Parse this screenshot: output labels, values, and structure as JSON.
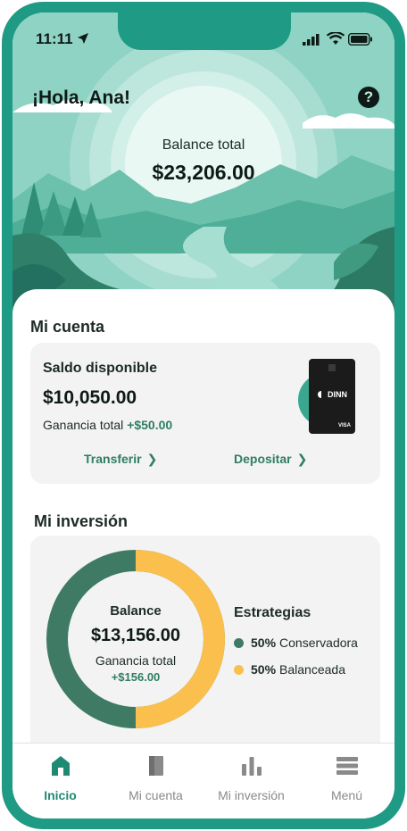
{
  "status_bar": {
    "time": "11:11"
  },
  "header": {
    "greeting": "¡Hola, Ana!",
    "help_icon": "question-circle-icon",
    "balance_label": "Balance total",
    "balance_value": "$23,206.00"
  },
  "account": {
    "title": "Mi cuenta",
    "saldo_label": "Saldo disponible",
    "saldo_value": "$10,050.00",
    "ganancia_label": "Ganancia total",
    "ganancia_value": "+$50.00",
    "transfer_label": "Transferir",
    "deposit_label": "Depositar",
    "card_brand": "DINN",
    "card_network": "VISA"
  },
  "investment": {
    "title": "Mi inversión",
    "balance_label": "Balance",
    "balance_value": "$13,156.00",
    "ganancia_label": "Ganancia total",
    "ganancia_value": "+$156.00",
    "strategies_title": "Estrategias",
    "strategies": [
      {
        "percent": "50%",
        "name": "Conservadora",
        "color": "#3e7a64"
      },
      {
        "percent": "50%",
        "name": "Balanceada",
        "color": "#fbbf4d"
      }
    ]
  },
  "tabbar": {
    "tabs": [
      {
        "label": "Inicio",
        "icon": "home-icon",
        "active": true
      },
      {
        "label": "Mi cuenta",
        "icon": "wallet-icon",
        "active": false
      },
      {
        "label": "Mi inversión",
        "icon": "bar-chart-icon",
        "active": false
      },
      {
        "label": "Menú",
        "icon": "menu-icon",
        "active": false
      }
    ]
  },
  "colors": {
    "frame": "#1f9a84",
    "accent_green": "#2e7d64",
    "donut_dark": "#3e7a64",
    "donut_yellow": "#fbbf4d"
  }
}
